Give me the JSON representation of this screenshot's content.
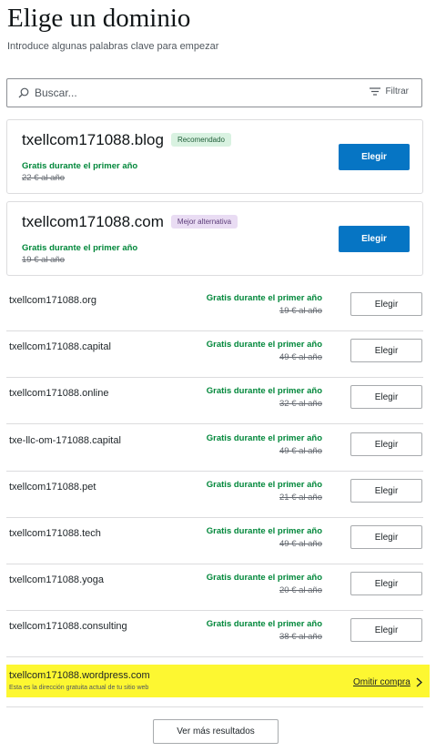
{
  "header": {
    "title": "Elige un dominio",
    "subtitle": "Introduce algunas palabras clave para empezar"
  },
  "search": {
    "placeholder": "Buscar...",
    "value": "",
    "filter_label": "Filtrar"
  },
  "featured": [
    {
      "domain": "txellcom171088.blog",
      "badge": "Recomendado",
      "badge_color": "#d9f2e1",
      "free_text": "Gratis durante el primer año",
      "old_price": "22 € al año",
      "button": "Elegir"
    },
    {
      "domain": "txellcom171088.com",
      "badge": "Mejor alternativa",
      "badge_color": "#e9dcf3",
      "free_text": "Gratis durante el primer año",
      "old_price": "19 € al año",
      "button": "Elegir"
    }
  ],
  "results": [
    {
      "name": "txellcom171088",
      "tld": ".org",
      "free_text": "Gratis durante el primer año",
      "old_price": "19 € al año",
      "button": "Elegir"
    },
    {
      "name": "txellcom171088",
      "tld": ".capital",
      "free_text": "Gratis durante el primer año",
      "old_price": "49 € al año",
      "button": "Elegir"
    },
    {
      "name": "txellcom171088",
      "tld": ".online",
      "free_text": "Gratis durante el primer año",
      "old_price": "32 € al año",
      "button": "Elegir"
    },
    {
      "name": "txe-llc-om-171088",
      "tld": ".capital",
      "free_text": "Gratis durante el primer año",
      "old_price": "49 € al año",
      "button": "Elegir"
    },
    {
      "name": "txellcom171088",
      "tld": ".pet",
      "free_text": "Gratis durante el primer año",
      "old_price": "21 € al año",
      "button": "Elegir"
    },
    {
      "name": "txellcom171088",
      "tld": ".tech",
      "free_text": "Gratis durante el primer año",
      "old_price": "49 € al año",
      "button": "Elegir"
    },
    {
      "name": "txellcom171088",
      "tld": ".yoga",
      "free_text": "Gratis durante el primer año",
      "old_price": "20 € al año",
      "button": "Elegir"
    },
    {
      "name": "txellcom171088",
      "tld": ".consulting",
      "free_text": "Gratis durante el primer año",
      "old_price": "38 € al año",
      "button": "Elegir"
    }
  ],
  "free_site": {
    "domain": "txellcom171088.wordpress.com",
    "description": "Esta es la dirección gratuita actual de tu sitio web",
    "skip_label": "Omitir compra",
    "highlight_color": "#fdf731"
  },
  "more_button": "Ver más resultados",
  "colors": {
    "accent": "#0675c4",
    "free_green": "#00873a"
  }
}
